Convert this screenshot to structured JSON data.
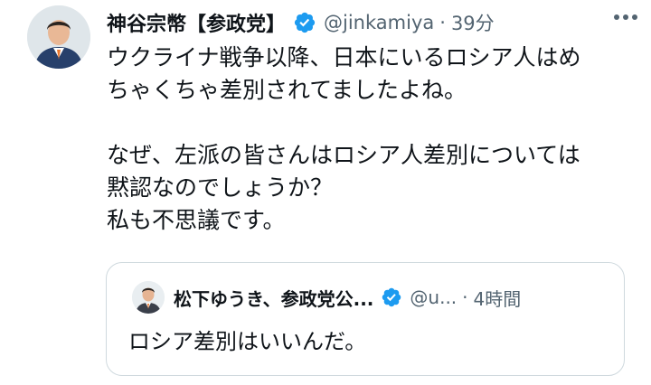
{
  "tweet": {
    "author_name": "神谷宗幣【参政党】",
    "handle": "@jinkamiya",
    "separator": "·",
    "time": "39分",
    "text": "ウクライナ戦争以降、日本にいるロシア人はめ\nちゃくちゃ差別されてましたよね。\n\nなぜ、左派の皆さんはロシア人差別については\n黙認なのでしょうか？\n私も不思議です。"
  },
  "quoted_tweet": {
    "author_name": "松下ゆうき、参政党公...",
    "handle": "@u...",
    "separator": "·",
    "time": "4時間",
    "text": "ロシア差別はいいんだ。"
  },
  "colors": {
    "verified_blue": "#1d9bf0",
    "secondary_text": "#536471",
    "border": "#cfd9de"
  },
  "icons": [
    "verified-badge-icon",
    "more-options-icon"
  ]
}
